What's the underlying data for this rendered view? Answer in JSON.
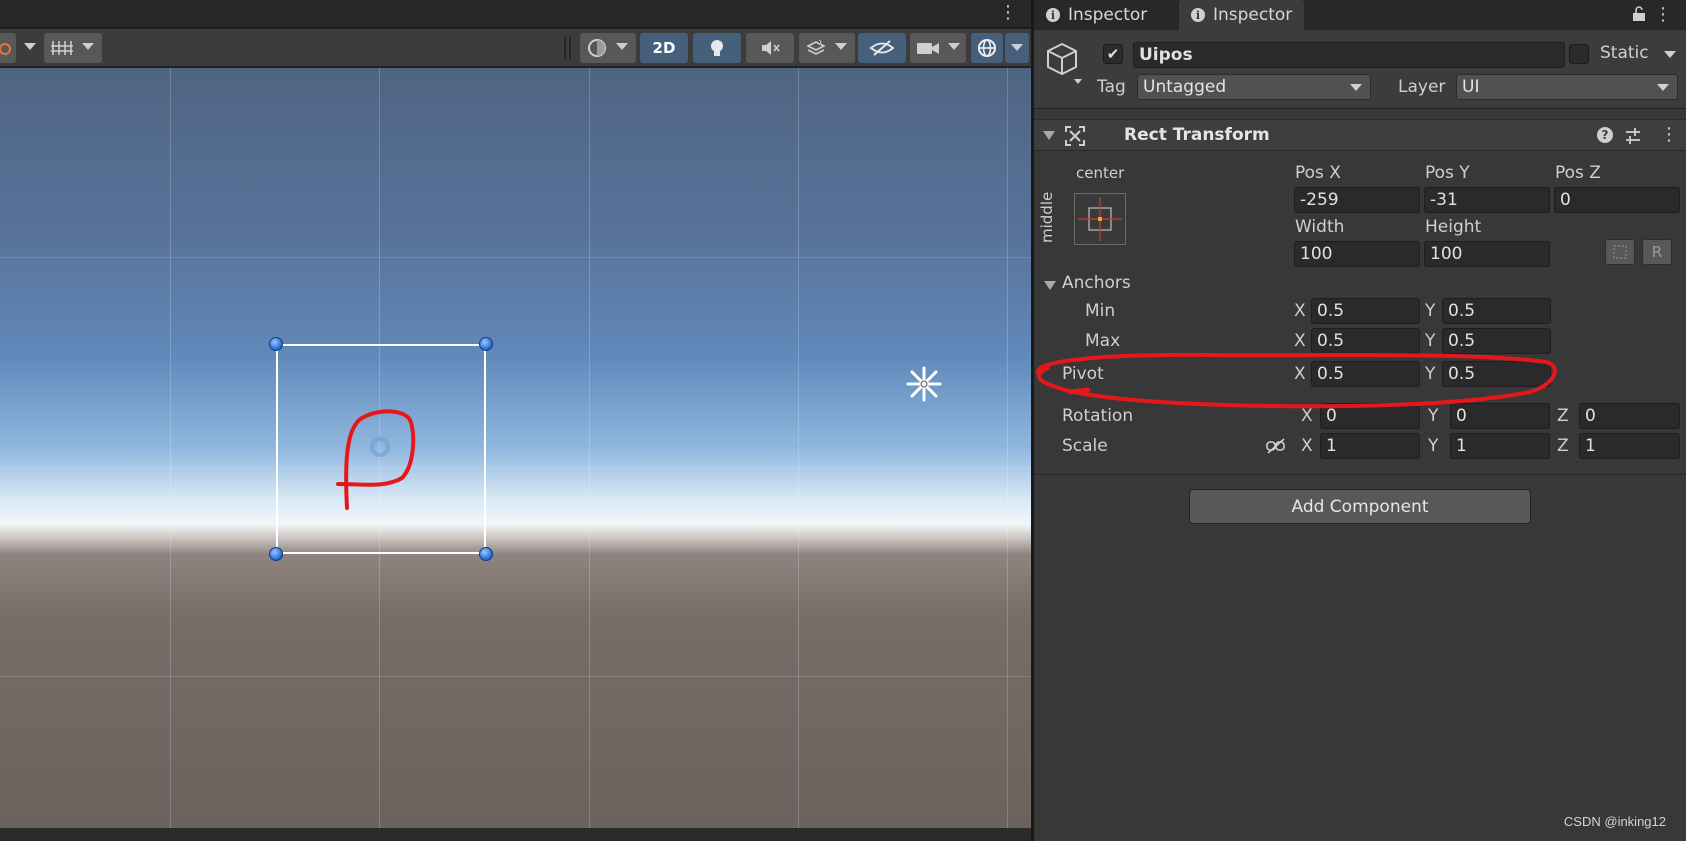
{
  "scene": {
    "toolbar": {
      "mode_2d_label": "2D"
    }
  },
  "inspector": {
    "tabs": [
      {
        "label": "Inspector"
      },
      {
        "label": "Inspector"
      }
    ],
    "object": {
      "active": true,
      "name": "Uipos",
      "static_label": "Static",
      "static_checked": false,
      "tag_label": "Tag",
      "tag_value": "Untagged",
      "layer_label": "Layer",
      "layer_value": "UI"
    },
    "rect_transform": {
      "title": "Rect Transform",
      "anchor_h_label": "center",
      "anchor_v_label": "middle",
      "pos_x_label": "Pos X",
      "pos_y_label": "Pos Y",
      "pos_z_label": "Pos Z",
      "pos_x": "-259",
      "pos_y": "-31",
      "pos_z": "0",
      "width_label": "Width",
      "height_label": "Height",
      "width": "100",
      "height": "100",
      "raw_button_label": "R",
      "anchors_label": "Anchors",
      "min_label": "Min",
      "max_label": "Max",
      "min_x": "0.5",
      "min_y": "0.5",
      "max_x": "0.5",
      "max_y": "0.5",
      "pivot_label": "Pivot",
      "pivot_x": "0.5",
      "pivot_y": "0.5",
      "rotation_label": "Rotation",
      "rot_x": "0",
      "rot_y": "0",
      "rot_z": "0",
      "scale_label": "Scale",
      "scale_x": "1",
      "scale_y": "1",
      "scale_z": "1",
      "x_label": "X",
      "y_label": "Y",
      "z_label": "Z"
    },
    "add_component_label": "Add Component"
  },
  "watermark": "CSDN @inking12",
  "colors": {
    "annotation_red": "#e4181b",
    "active_toolbar": "#46607c",
    "handle_blue": "#1e66d0"
  },
  "icons": [
    "cube-icon",
    "lock-icon",
    "info-icon",
    "help-icon",
    "preset-icon",
    "kebab-icon",
    "link-icon",
    "light-bulb-icon",
    "audio-icon",
    "effects-icon",
    "visibility-icon",
    "camera-icon",
    "gizmo-icon"
  ]
}
